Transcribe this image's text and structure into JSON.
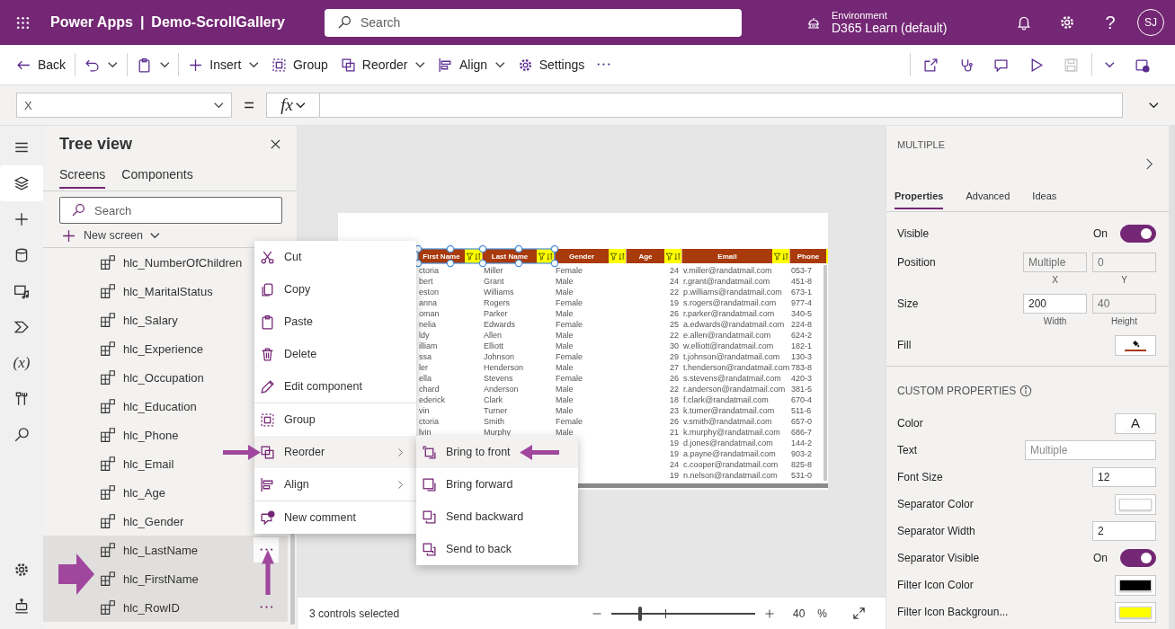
{
  "app_bar": {
    "app_name": "Power Apps",
    "separator": "|",
    "document_title": "Demo-ScrollGallery",
    "search_placeholder": "Search",
    "environment_label": "Environment",
    "environment_name": "D365 Learn (default)",
    "help_glyph": "?",
    "avatar_initials": "SJ"
  },
  "command_bar": {
    "left_groups": [
      [
        {
          "kind": "back",
          "label": "Back",
          "has_menu": false
        }
      ],
      [
        {
          "kind": "undo",
          "has_menu": true
        }
      ],
      [
        {
          "kind": "paste",
          "has_menu": true
        }
      ],
      [
        {
          "kind": "insert",
          "label": "Insert",
          "has_menu": true
        },
        {
          "kind": "group",
          "label": "Group",
          "has_menu": false
        },
        {
          "kind": "reorder",
          "label": "Reorder",
          "has_menu": true
        },
        {
          "kind": "align",
          "label": "Align",
          "has_menu": true
        },
        {
          "kind": "settings",
          "label": "Settings",
          "has_menu": false
        },
        {
          "kind": "more",
          "has_menu": false
        }
      ]
    ],
    "right_groups": [
      [
        {
          "kind": "share",
          "disabled": false
        },
        {
          "kind": "checker",
          "disabled": false
        },
        {
          "kind": "comment",
          "disabled": false
        },
        {
          "kind": "play",
          "disabled": false
        },
        {
          "kind": "save",
          "disabled": true
        }
      ],
      [
        {
          "kind": "caret",
          "disabled": false
        },
        {
          "kind": "publish",
          "disabled": false
        }
      ]
    ]
  },
  "formula_bar": {
    "property": "X",
    "equals": "=",
    "fx_label": "fx"
  },
  "left_rail": {
    "items": [
      {
        "kind": "menu",
        "selected": false
      },
      {
        "kind": "layers",
        "selected": true
      },
      {
        "kind": "plus",
        "selected": false
      },
      {
        "kind": "database",
        "selected": false
      },
      {
        "kind": "media",
        "selected": false
      },
      {
        "kind": "automate",
        "selected": false
      },
      {
        "kind": "variables",
        "glyph": "(x)",
        "selected": false
      },
      {
        "kind": "tools",
        "selected": false
      },
      {
        "kind": "search",
        "selected": false
      }
    ],
    "bottom_items": [
      {
        "kind": "settings",
        "selected": false
      },
      {
        "kind": "bot",
        "selected": false
      }
    ]
  },
  "tree_view": {
    "title": "Tree view",
    "tabs": [
      {
        "label": "Screens",
        "selected": true
      },
      {
        "label": "Components",
        "selected": false
      }
    ],
    "search_placeholder": "Search",
    "new_screen": "New screen",
    "items": [
      {
        "label": "hlc_NumberOfChildren",
        "selected": false
      },
      {
        "label": "hlc_MaritalStatus",
        "selected": false
      },
      {
        "label": "hlc_Salary",
        "selected": false
      },
      {
        "label": "hlc_Experience",
        "selected": false
      },
      {
        "label": "hlc_Occupation",
        "selected": false
      },
      {
        "label": "hlc_Education",
        "selected": false
      },
      {
        "label": "hlc_Phone",
        "selected": false
      },
      {
        "label": "hlc_Email",
        "selected": false
      },
      {
        "label": "hlc_Age",
        "selected": false
      },
      {
        "label": "hlc_Gender",
        "selected": false
      },
      {
        "label": "hlc_LastName",
        "selected": true,
        "more_button": {
          "hovered": true
        }
      },
      {
        "label": "hlc_FirstName",
        "selected": true
      },
      {
        "label": "hlc_RowID",
        "selected": true,
        "more_button": {
          "hovered": false
        }
      }
    ]
  },
  "gallery": {
    "columns": [
      {
        "header": "First Name",
        "selected": true
      },
      {
        "header": "Last Name",
        "selected": true
      },
      {
        "header": "Gender",
        "selected": false
      },
      {
        "header": "Age",
        "selected": false
      },
      {
        "header": "Email",
        "selected": false
      },
      {
        "header": "Phone",
        "selected": false
      }
    ],
    "rows": [
      {
        "first_name": "ctoria",
        "last_name": "Miller",
        "gender": "Female",
        "age": "24",
        "email": "v.miller@randatmail.com",
        "phone": "053-7"
      },
      {
        "first_name": "bert",
        "last_name": "Grant",
        "gender": "Male",
        "age": "24",
        "email": "r.grant@randatmail.com",
        "phone": "451-8"
      },
      {
        "first_name": "eston",
        "last_name": "Williams",
        "gender": "Male",
        "age": "22",
        "email": "p.williams@randatmail.com",
        "phone": "673-1"
      },
      {
        "first_name": "anna",
        "last_name": "Rogers",
        "gender": "Female",
        "age": "19",
        "email": "s.rogers@randatmail.com",
        "phone": "977-4"
      },
      {
        "first_name": "oman",
        "last_name": "Parker",
        "gender": "Male",
        "age": "26",
        "email": "r.parker@randatmail.com",
        "phone": "340-5"
      },
      {
        "first_name": "nelia",
        "last_name": "Edwards",
        "gender": "Female",
        "age": "25",
        "email": "a.edwards@randatmail.com",
        "phone": "224-8"
      },
      {
        "first_name": "ldy",
        "last_name": "Allen",
        "gender": "Male",
        "age": "22",
        "email": "e.allen@randatmail.com",
        "phone": "624-2"
      },
      {
        "first_name": "illiam",
        "last_name": "Elliott",
        "gender": "Male",
        "age": "30",
        "email": "w.elliott@randatmail.com",
        "phone": "182-1"
      },
      {
        "first_name": "ssa",
        "last_name": "Johnson",
        "gender": "Female",
        "age": "29",
        "email": "t.johnson@randatmail.com",
        "phone": "130-3"
      },
      {
        "first_name": "ler",
        "last_name": "Henderson",
        "gender": "Male",
        "age": "27",
        "email": "t.henderson@randatmail.com",
        "phone": "783-8"
      },
      {
        "first_name": "ella",
        "last_name": "Stevens",
        "gender": "Female",
        "age": "26",
        "email": "s.stevens@randatmail.com",
        "phone": "420-3"
      },
      {
        "first_name": "chard",
        "last_name": "Anderson",
        "gender": "Male",
        "age": "22",
        "email": "r.anderson@randatmail.com",
        "phone": "381-5"
      },
      {
        "first_name": "ederick",
        "last_name": "Clark",
        "gender": "Male",
        "age": "18",
        "email": "f.clark@randatmail.com",
        "phone": "670-4"
      },
      {
        "first_name": "vin",
        "last_name": "Turner",
        "gender": "Male",
        "age": "23",
        "email": "k.turner@randatmail.com",
        "phone": "511-6"
      },
      {
        "first_name": "ctoria",
        "last_name": "Smith",
        "gender": "Female",
        "age": "26",
        "email": "v.smith@randatmail.com",
        "phone": "657-0"
      },
      {
        "first_name": "lvin",
        "last_name": "Murphy",
        "gender": "Male",
        "age": "21",
        "email": "k.murphy@randatmail.com",
        "phone": "686-7"
      },
      {
        "age": "19",
        "email": "d.jones@randatmail.com",
        "phone": "144-2"
      },
      {
        "age": "19",
        "email": "a.payne@randatmail.com",
        "phone": "903-2"
      },
      {
        "age": "24",
        "email": "c.cooper@randatmail.com",
        "phone": "825-8"
      },
      {
        "age": "19",
        "email": "n.nelson@randatmail.com",
        "phone": "531-0"
      }
    ]
  },
  "context_menu": {
    "groups": [
      [
        {
          "kind": "cut",
          "label": "Cut",
          "has_submenu": false,
          "highlighted": false
        },
        {
          "kind": "copy",
          "label": "Copy",
          "has_submenu": false,
          "highlighted": false
        },
        {
          "kind": "paste",
          "label": "Paste",
          "has_submenu": false,
          "highlighted": false
        },
        {
          "kind": "delete",
          "label": "Delete",
          "has_submenu": false,
          "highlighted": false
        },
        {
          "kind": "edit",
          "label": "Edit component",
          "has_submenu": false,
          "highlighted": false
        }
      ],
      [
        {
          "kind": "group",
          "label": "Group",
          "has_submenu": false,
          "highlighted": false
        },
        {
          "kind": "reorder",
          "label": "Reorder",
          "has_submenu": true,
          "highlighted": true
        },
        {
          "kind": "align",
          "label": "Align",
          "has_submenu": true,
          "highlighted": false
        }
      ],
      [
        {
          "kind": "comment_add",
          "label": "New comment",
          "has_submenu": false,
          "highlighted": false
        }
      ]
    ]
  },
  "submenu": {
    "items": [
      {
        "kind": "bring_front",
        "label": "Bring to front",
        "highlighted": true
      },
      {
        "kind": "bring_forward",
        "label": "Bring forward",
        "highlighted": false
      },
      {
        "kind": "send_backward",
        "label": "Send backward",
        "highlighted": false
      },
      {
        "kind": "send_back",
        "label": "Send to back",
        "highlighted": false
      }
    ]
  },
  "status_bar": {
    "selection": "3 controls selected",
    "zoom": {
      "level": 0.2,
      "value": "40",
      "unit": "%"
    }
  },
  "properties_panel": {
    "heading": "MULTIPLE",
    "tabs": [
      {
        "label": "Properties",
        "selected": true
      },
      {
        "label": "Advanced",
        "selected": false
      },
      {
        "label": "Ideas",
        "selected": false
      }
    ],
    "rows": [
      {
        "kind": "toggle",
        "label": "Visible",
        "value": "On",
        "on": true
      },
      {
        "kind": "pair",
        "label": "Position",
        "fields": [
          {
            "value": "Multiple",
            "caption": "X",
            "disabled": true
          },
          {
            "value": "0",
            "caption": "Y",
            "disabled": true
          }
        ]
      },
      {
        "kind": "pair",
        "label": "Size",
        "fields": [
          {
            "value": "200",
            "caption": "Width",
            "disabled": false
          },
          {
            "value": "40",
            "caption": "Height",
            "disabled": true
          }
        ]
      },
      {
        "kind": "fill",
        "label": "Fill",
        "color": "#a83a0c"
      }
    ],
    "custom_heading": "CUSTOM PROPERTIES",
    "custom_rows": [
      {
        "kind": "font_color",
        "label": "Color",
        "glyph": "A"
      },
      {
        "kind": "wide_input",
        "label": "Text",
        "placeholder": "Multiple"
      },
      {
        "kind": "input",
        "label": "Font Size",
        "value": "12"
      },
      {
        "kind": "swatch",
        "label": "Separator Color",
        "color": "#ffffff"
      },
      {
        "kind": "input",
        "label": "Separator Width",
        "value": "2"
      },
      {
        "kind": "toggle",
        "label": "Separator Visible",
        "value": "On",
        "on": true
      },
      {
        "kind": "swatch",
        "label": "Filter Icon Color",
        "color": "#000000"
      },
      {
        "kind": "swatch",
        "label": "Filter Icon Backgroun...",
        "color": "#ffff00"
      }
    ]
  }
}
